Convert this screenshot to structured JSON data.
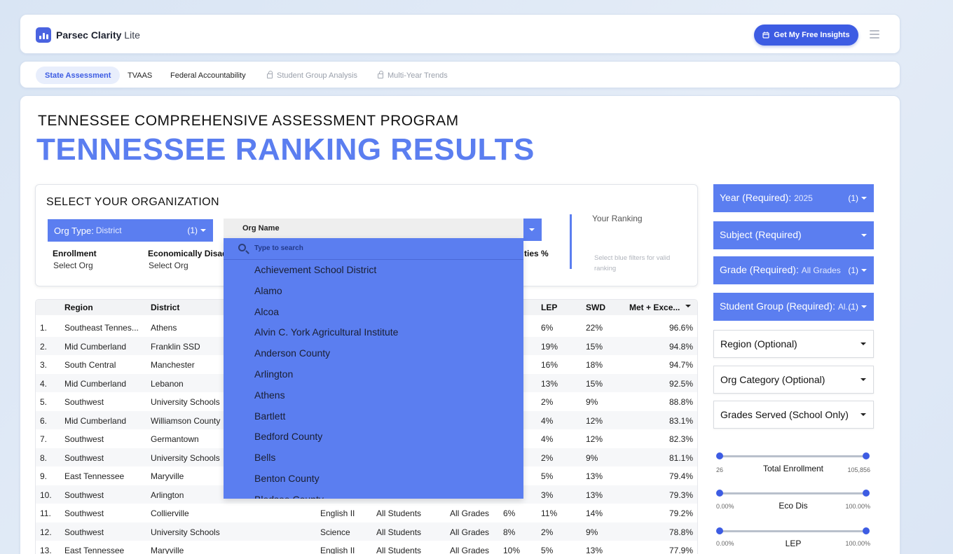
{
  "header": {
    "brand": "Parsec Clarity",
    "brand_suffix": "Lite",
    "cta_label": "Get My Free Insights"
  },
  "tabs": [
    {
      "label": "State Assessment",
      "active": true,
      "locked": false
    },
    {
      "label": "TVAAS",
      "active": false,
      "locked": false
    },
    {
      "label": "Federal Accountability",
      "active": false,
      "locked": false
    },
    {
      "label": "Student Group Analysis",
      "active": false,
      "locked": true
    },
    {
      "label": "Multi-Year Trends",
      "active": false,
      "locked": true
    }
  ],
  "page": {
    "subtitle": "TENNESSEE COMPREHENSIVE ASSESSMENT PROGRAM",
    "title": "TENNESSEE RANKING RESULTS"
  },
  "org_select": {
    "heading": "SELECT YOUR ORGANIZATION",
    "org_type": {
      "label": "Org Type",
      "value": "District",
      "count": "(1)"
    },
    "org_name": {
      "label": "Org Name",
      "search_placeholder": "Type to search"
    },
    "metrics": [
      {
        "label": "Enrollment",
        "value": "Select Org"
      },
      {
        "label": "Economically Disadv",
        "value": "Select Org"
      },
      {
        "label": "ties %",
        "value": ""
      }
    ],
    "ranking_label": "Your Ranking",
    "ranking_hint": "Select blue filters for valid ranking"
  },
  "org_options": [
    "Achievement School District",
    "Alamo",
    "Alcoa",
    "Alvin C. York Agricultural Institute",
    "Anderson County",
    "Arlington",
    "Athens",
    "Bartlett",
    "Bedford County",
    "Bells",
    "Benton County",
    "Bledsoe County"
  ],
  "table": {
    "columns": [
      "Region",
      "District",
      "LEP",
      "SWD",
      "Met + Exce..."
    ],
    "rows": [
      {
        "rank": "1.",
        "region": "Southeast Tennes...",
        "district": "Athens",
        "subject": "",
        "group": "",
        "grade": "",
        "ed": "",
        "lep": "6%",
        "swd": "22%",
        "met": "96.6%"
      },
      {
        "rank": "2.",
        "region": "Mid Cumberland",
        "district": "Franklin SSD",
        "subject": "",
        "group": "",
        "grade": "",
        "ed": "",
        "lep": "19%",
        "swd": "15%",
        "met": "94.8%"
      },
      {
        "rank": "3.",
        "region": "South Central",
        "district": "Manchester",
        "subject": "",
        "group": "",
        "grade": "",
        "ed": "",
        "lep": "16%",
        "swd": "18%",
        "met": "94.7%"
      },
      {
        "rank": "4.",
        "region": "Mid Cumberland",
        "district": "Lebanon",
        "subject": "",
        "group": "",
        "grade": "",
        "ed": "",
        "lep": "13%",
        "swd": "15%",
        "met": "92.5%"
      },
      {
        "rank": "5.",
        "region": "Southwest",
        "district": "University Schools",
        "subject": "",
        "group": "",
        "grade": "",
        "ed": "",
        "lep": "2%",
        "swd": "9%",
        "met": "88.8%"
      },
      {
        "rank": "6.",
        "region": "Mid Cumberland",
        "district": "Williamson County",
        "subject": "",
        "group": "",
        "grade": "",
        "ed": "",
        "lep": "4%",
        "swd": "12%",
        "met": "83.1%"
      },
      {
        "rank": "7.",
        "region": "Southwest",
        "district": "Germantown",
        "subject": "",
        "group": "",
        "grade": "",
        "ed": "",
        "lep": "4%",
        "swd": "12%",
        "met": "82.3%"
      },
      {
        "rank": "8.",
        "region": "Southwest",
        "district": "University Schools",
        "subject": "",
        "group": "",
        "grade": "",
        "ed": "",
        "lep": "2%",
        "swd": "9%",
        "met": "81.1%"
      },
      {
        "rank": "9.",
        "region": "East Tennessee",
        "district": "Maryville",
        "subject": "",
        "group": "",
        "grade": "",
        "ed": "",
        "lep": "5%",
        "swd": "13%",
        "met": "79.4%"
      },
      {
        "rank": "10.",
        "region": "Southwest",
        "district": "Arlington",
        "subject": "",
        "group": "",
        "grade": "",
        "ed": "",
        "lep": "3%",
        "swd": "13%",
        "met": "79.3%"
      },
      {
        "rank": "11.",
        "region": "Southwest",
        "district": "Collierville",
        "subject": "English II",
        "group": "All Students",
        "grade": "All Grades",
        "ed": "6%",
        "lep": "11%",
        "swd": "14%",
        "met": "79.2%"
      },
      {
        "rank": "12.",
        "region": "Southwest",
        "district": "University Schools",
        "subject": "Science",
        "group": "All Students",
        "grade": "All Grades",
        "ed": "8%",
        "lep": "2%",
        "swd": "9%",
        "met": "78.8%"
      },
      {
        "rank": "13.",
        "region": "East Tennessee",
        "district": "Maryville",
        "subject": "English II",
        "group": "All Students",
        "grade": "All Grades",
        "ed": "10%",
        "lep": "5%",
        "swd": "13%",
        "met": "77.9%"
      }
    ]
  },
  "filters": {
    "year": {
      "label": "Year (Required):",
      "value": "2025",
      "count": "(1)"
    },
    "subject": {
      "label": "Subject (Required)",
      "value": "",
      "count": ""
    },
    "grade": {
      "label": "Grade (Required):",
      "value": "All Grades",
      "count": "(1)"
    },
    "student_group": {
      "label": "Student Group (Required):",
      "value": "Al...",
      "count": "(1)"
    },
    "region": {
      "label": "Region (Optional)"
    },
    "org_category": {
      "label": "Org Category (Optional)"
    },
    "grades_served": {
      "label": "Grades Served (School Only)"
    }
  },
  "sliders": [
    {
      "label": "Total Enrollment",
      "min": "26",
      "max": "105,856"
    },
    {
      "label": "Eco Dis",
      "min": "0.00%",
      "max": "100.00%"
    },
    {
      "label": "LEP",
      "min": "0.00%",
      "max": "100.00%"
    }
  ],
  "colors": {
    "accent": "#5b7ef0",
    "cta": "#3d5ce3",
    "title": "#5b7ef0"
  }
}
